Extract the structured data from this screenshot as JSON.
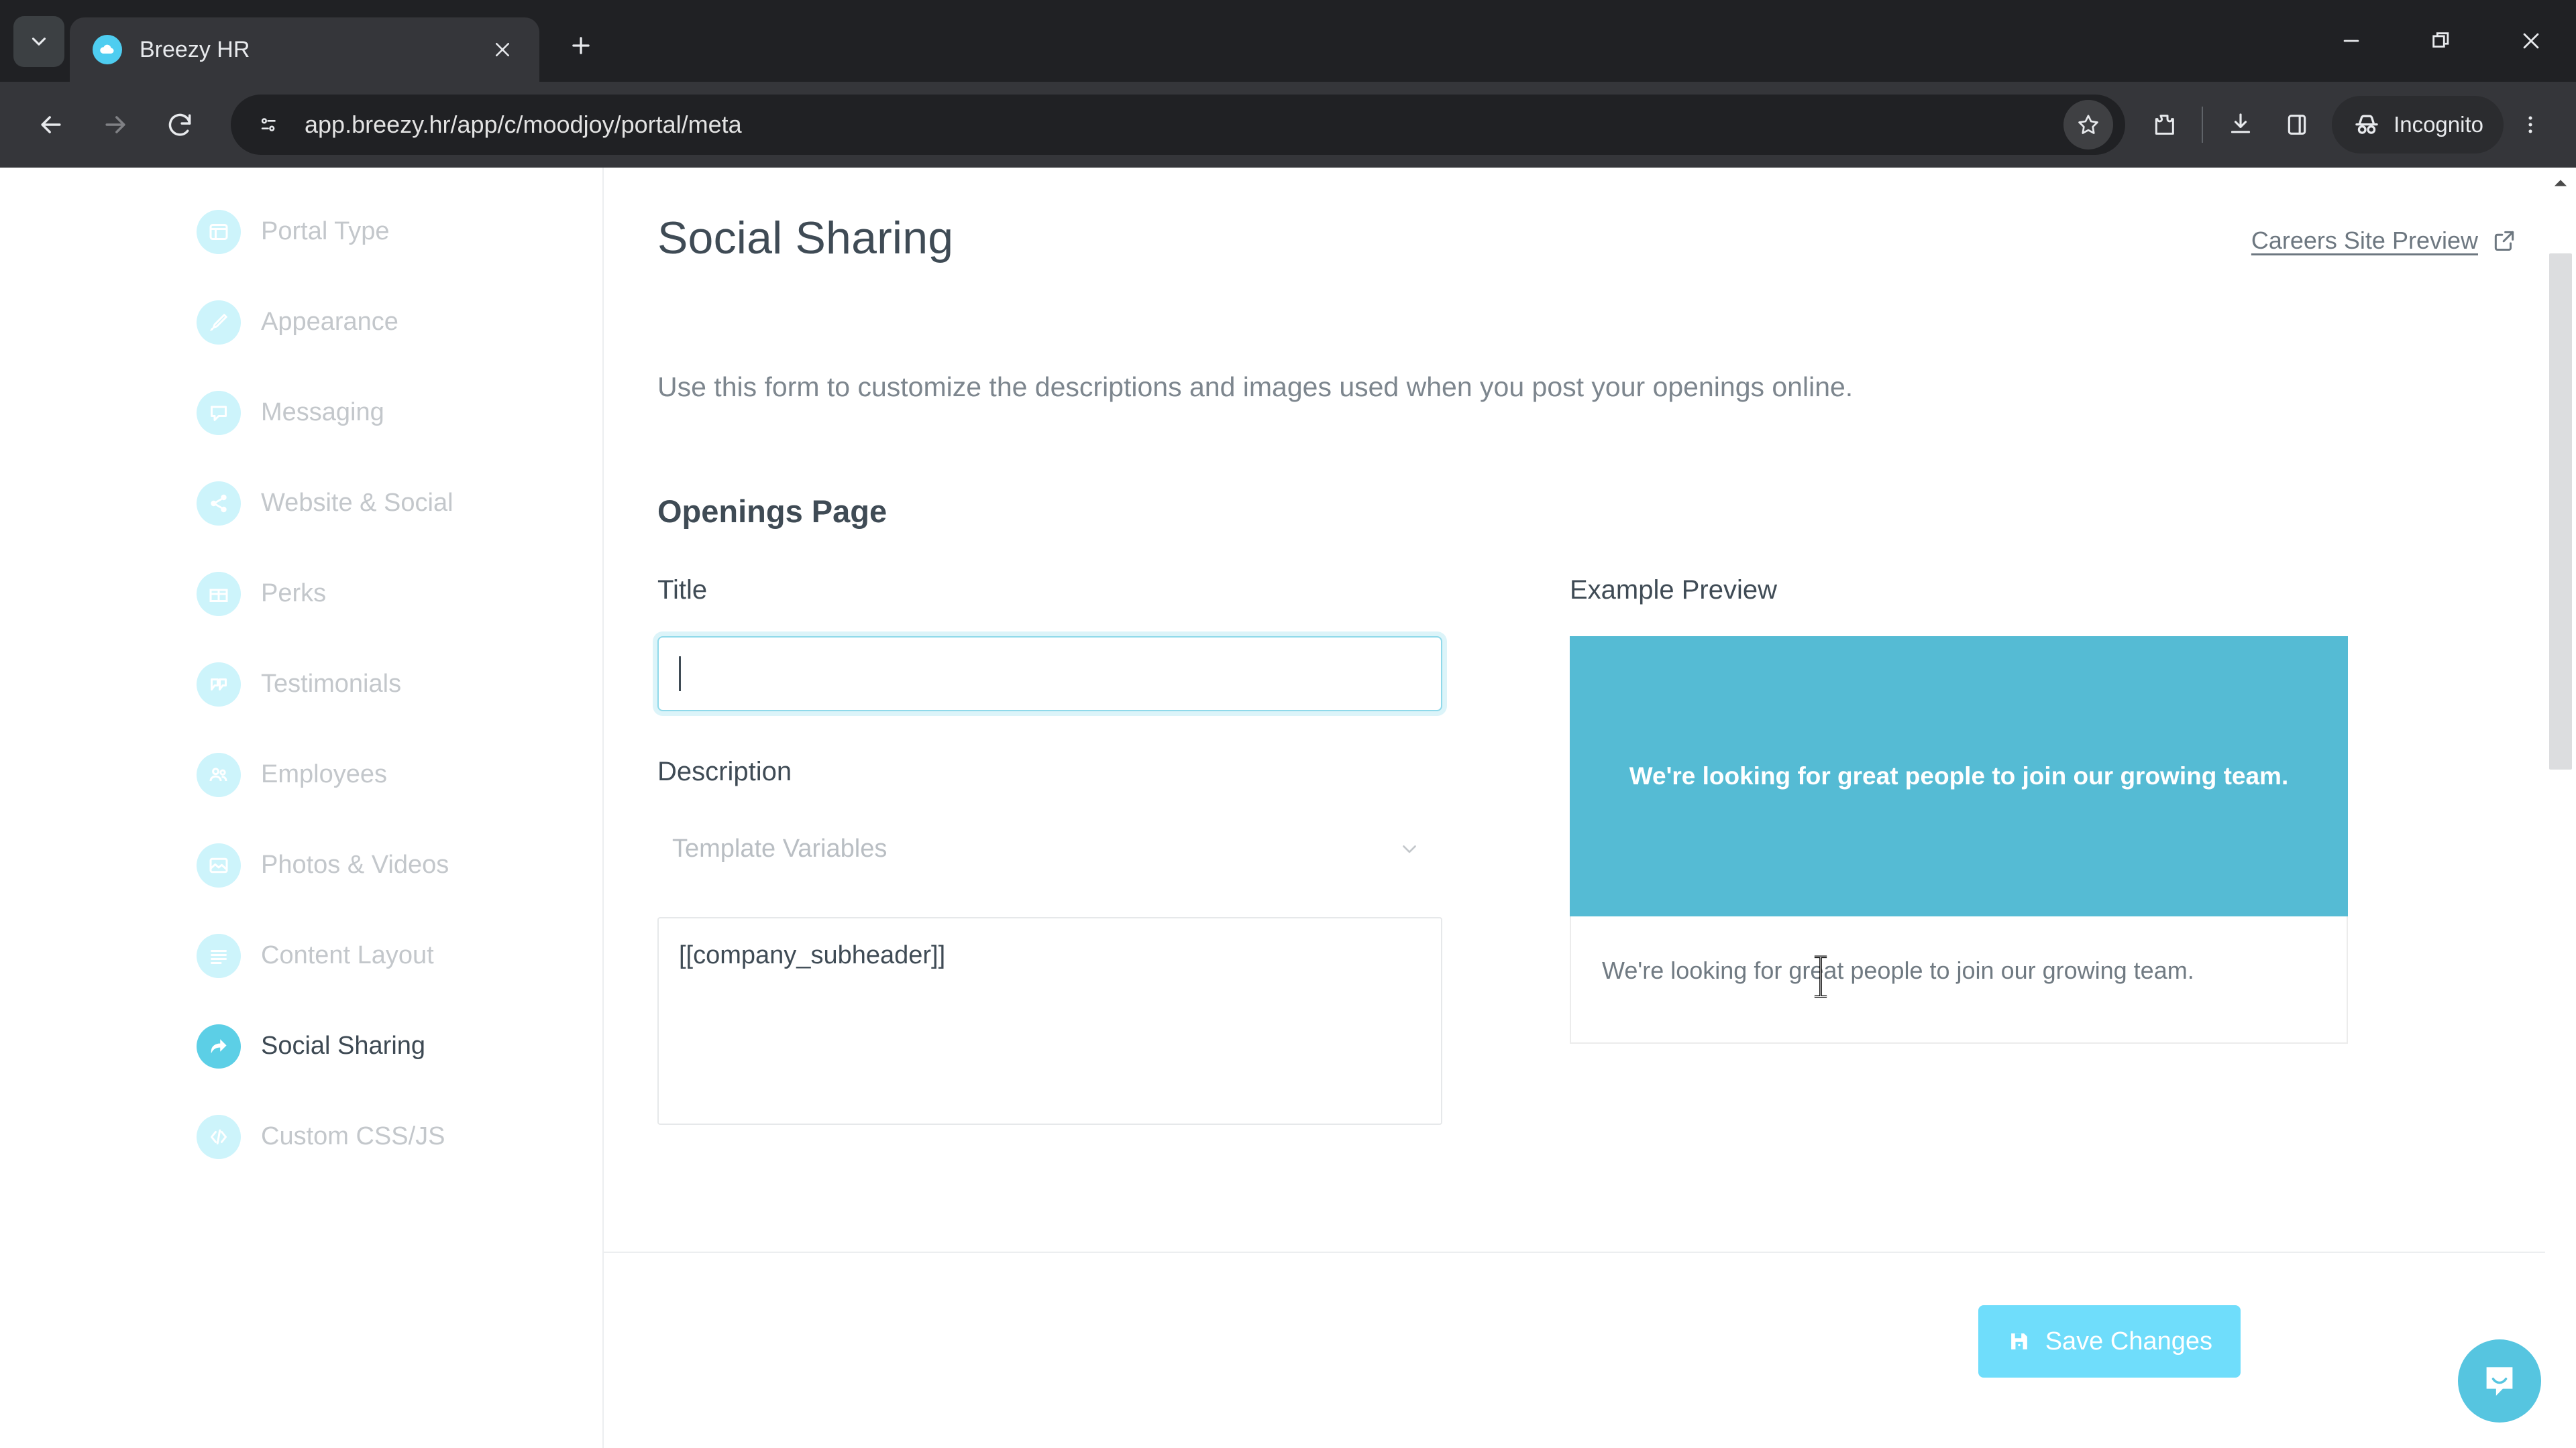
{
  "browser": {
    "tab": {
      "title": "Breezy HR",
      "favicon_icon": "breezy-cloud-icon",
      "close_icon": "close-icon"
    },
    "tab_search_icon": "chevron-down-icon",
    "new_tab_icon": "plus-icon",
    "window_controls": {
      "minimize_icon": "minimize-icon",
      "restore_icon": "restore-icon",
      "close_icon": "close-icon"
    },
    "nav": {
      "back_icon": "arrow-left-icon",
      "forward_icon": "arrow-right-icon",
      "reload_icon": "reload-icon"
    },
    "omnibox": {
      "site_info_icon": "page-settings-icon",
      "url": "app.breezy.hr/app/c/moodjoy/portal/meta",
      "bookmark_icon": "star-icon"
    },
    "toolbar_icons": {
      "extensions_icon": "extensions-puzzle-icon",
      "downloads_icon": "download-icon",
      "side_panel_icon": "side-panel-icon",
      "menu_icon": "kebab-menu-icon"
    },
    "incognito": {
      "label": "Incognito",
      "icon": "incognito-icon"
    }
  },
  "sidebar": {
    "items": [
      {
        "label": "Portal Type",
        "icon": "portal-type-icon",
        "active": false
      },
      {
        "label": "Appearance",
        "icon": "brush-icon",
        "active": false
      },
      {
        "label": "Messaging",
        "icon": "chat-bubble-icon",
        "active": false
      },
      {
        "label": "Website & Social",
        "icon": "share-icon",
        "active": false
      },
      {
        "label": "Perks",
        "icon": "gift-icon",
        "active": false
      },
      {
        "label": "Testimonials",
        "icon": "quote-icon",
        "active": false
      },
      {
        "label": "Employees",
        "icon": "people-icon",
        "active": false
      },
      {
        "label": "Photos & Videos",
        "icon": "image-icon",
        "active": false
      },
      {
        "label": "Content Layout",
        "icon": "layout-lines-icon",
        "active": false
      },
      {
        "label": "Social Sharing",
        "icon": "share-arrow-icon",
        "active": true
      },
      {
        "label": "Custom CSS/JS",
        "icon": "code-icon",
        "active": false
      }
    ]
  },
  "main": {
    "page_title": "Social Sharing",
    "careers_preview": {
      "label": "Careers Site Preview",
      "icon": "external-link-icon"
    },
    "intro": "Use this form to customize the descriptions and images used when you post your openings online.",
    "section_title": "Openings Page",
    "form": {
      "title_label": "Title",
      "title_value": "",
      "title_placeholder": "",
      "description_label": "Description",
      "template_variables_label": "Template Variables",
      "template_variables_chevron": "chevron-down-icon",
      "description_value": "[[company_subheader]]"
    },
    "preview": {
      "heading": "Example Preview",
      "banner_text": "We're looking for great people to join our growing team.",
      "caption": "We're looking for great people to join our growing team.",
      "banner_color": "#55bbd4"
    },
    "footer": {
      "save_label": "Save Changes",
      "save_icon": "floppy-save-icon",
      "save_color": "#6fddfb"
    }
  },
  "widgets": {
    "intercom": {
      "icon": "intercom-chat-icon",
      "color": "#56c5e0"
    },
    "scrollbar": {
      "up_arrow_icon": "scroll-up-arrow-icon"
    },
    "cursor": {
      "icon": "text-ibeam-cursor"
    }
  }
}
